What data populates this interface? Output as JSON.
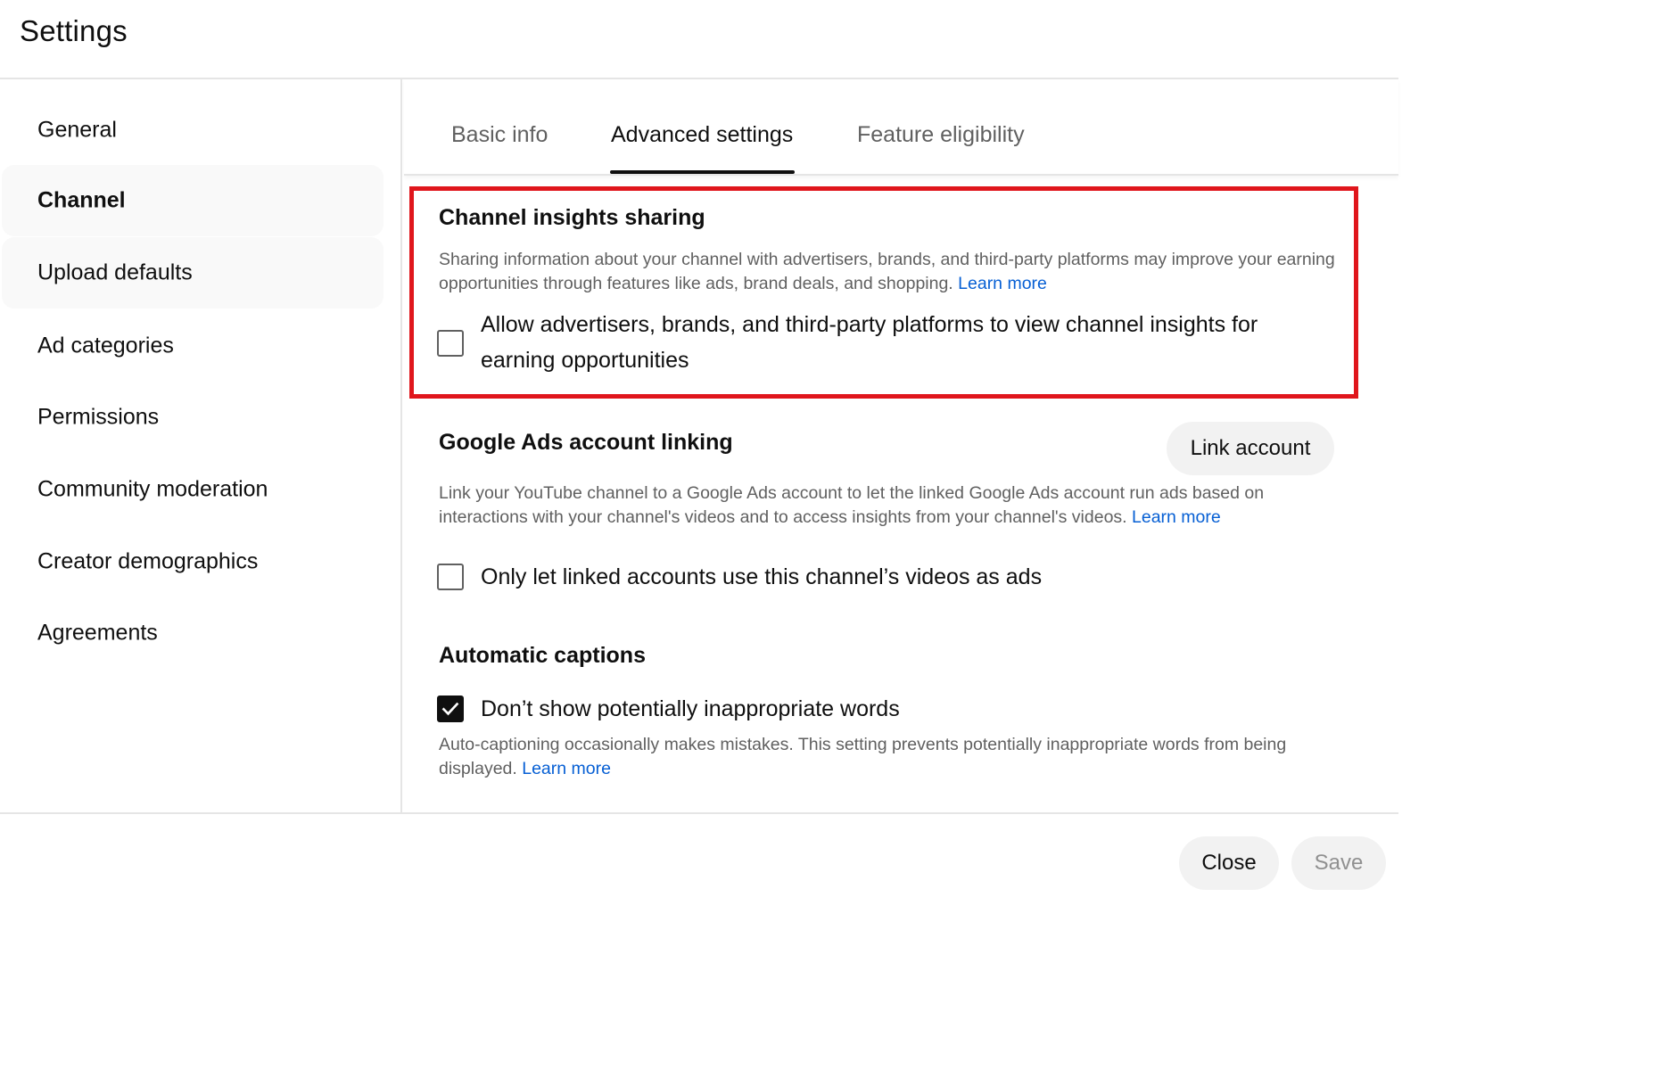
{
  "header": {
    "title": "Settings"
  },
  "sidebar": {
    "items": [
      {
        "label": "General"
      },
      {
        "label": "Channel"
      },
      {
        "label": "Upload defaults"
      },
      {
        "label": "Ad categories"
      },
      {
        "label": "Permissions"
      },
      {
        "label": "Community moderation"
      },
      {
        "label": "Creator demographics"
      },
      {
        "label": "Agreements"
      }
    ],
    "active": "Channel"
  },
  "tabs": {
    "items": [
      {
        "label": "Basic info"
      },
      {
        "label": "Advanced settings"
      },
      {
        "label": "Feature eligibility"
      }
    ],
    "active": "Advanced settings"
  },
  "insights": {
    "title": "Channel insights sharing",
    "description": "Sharing information about your channel with advertisers, brands, and third-party platforms may improve your earning opportunities through features like ads, brand deals, and shopping.",
    "learn_more": "Learn more",
    "checkbox_label_line1": "Allow advertisers, brands, and third-party platforms to view channel insights for",
    "checkbox_label_line2": "earning opportunities",
    "checked": false
  },
  "ads_linking": {
    "title": "Google Ads account linking",
    "link_button": "Link account",
    "description": "Link your YouTube channel to a Google Ads account to let the linked Google Ads account run ads based on interactions with your channel's videos and to access insights from your channel's videos.",
    "learn_more": "Learn more",
    "checkbox_label": "Only let linked accounts use this channel’s videos as ads",
    "checked": false
  },
  "captions": {
    "title": "Automatic captions",
    "checkbox_label": "Don’t show potentially inappropriate words",
    "checked": true,
    "description": "Auto-captioning occasionally makes mistakes. This setting prevents potentially inappropriate words from being displayed.",
    "learn_more": "Learn more"
  },
  "footer": {
    "close_label": "Close",
    "save_label": "Save",
    "save_disabled": true
  },
  "colors": {
    "highlight": "#e0161c",
    "link": "#065fd4",
    "text_secondary": "#606060"
  }
}
